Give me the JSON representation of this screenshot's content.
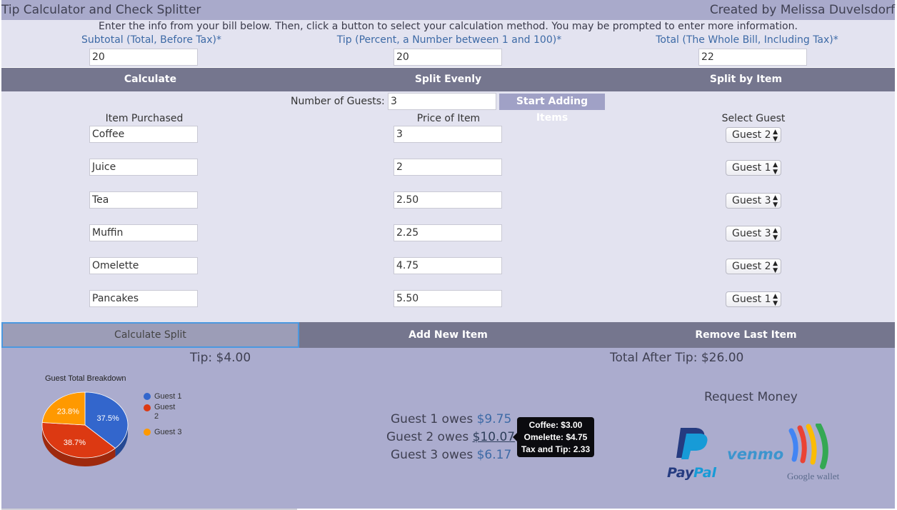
{
  "header": {
    "title": "Tip Calculator and Check Splitter",
    "author": "Created by Melissa Duvelsdorf"
  },
  "instructions": "Enter the info from your bill below. Then, click a button to select your calculation method. You may be prompted to enter more information.",
  "fields": {
    "subtotal_label": "Subtotal (Total, Before Tax)*",
    "subtotal_value": "20",
    "tip_label": "Tip (Percent, a Number between 1 and 100)*",
    "tip_value": "20",
    "total_label": "Total (The Whole Bill, Including Tax)*",
    "total_value": "22"
  },
  "methods": {
    "calculate": "Calculate",
    "split_evenly": "Split Evenly",
    "split_by_item": "Split by Item"
  },
  "guests": {
    "label": "Number of Guests:",
    "value": "3",
    "start_button": "Start Adding Items"
  },
  "columns": {
    "item": "Item Purchased",
    "price": "Price of Item",
    "guest": "Select Guest"
  },
  "items": [
    {
      "name": "Coffee",
      "price": "3",
      "guest": "Guest 2"
    },
    {
      "name": "Juice",
      "price": "2",
      "guest": "Guest 1"
    },
    {
      "name": "Tea",
      "price": "2.50",
      "guest": "Guest 3"
    },
    {
      "name": "Muffin",
      "price": "2.25",
      "guest": "Guest 3"
    },
    {
      "name": "Omelette",
      "price": "4.75",
      "guest": "Guest 2"
    },
    {
      "name": "Pancakes",
      "price": "5.50",
      "guest": "Guest 1"
    }
  ],
  "actions": {
    "calculate_split": "Calculate Split",
    "add_item": "Add New Item",
    "remove_item": "Remove Last Item"
  },
  "results": {
    "tip": "Tip: $4.00",
    "total_after_tip": "Total After Tip: $26.00",
    "owes": [
      {
        "label": "Guest 1 owes",
        "amount": "$9.75"
      },
      {
        "label": "Guest 2 owes",
        "amount": "$10.07"
      },
      {
        "label": "Guest 3 owes",
        "amount": "$6.17"
      }
    ],
    "tooltip": [
      "Coffee: $3.00",
      "Omelette: $4.75",
      "Tax and Tip: 2.33"
    ],
    "request_money": "Request Money",
    "payment_options": [
      "PayPal",
      "venmo",
      "Google wallet"
    ]
  },
  "chart_data": {
    "type": "pie",
    "title": "Guest Total Breakdown",
    "categories": [
      "Guest 1",
      "Guest 2",
      "Guest 3"
    ],
    "values": [
      37.5,
      38.7,
      23.8
    ],
    "labels": [
      "37.5%",
      "38.7%",
      "23.8%"
    ],
    "colors": [
      "#3366cc",
      "#dc3912",
      "#ff9900"
    ],
    "legend": "right",
    "style": "3d"
  },
  "colors": {
    "header": "#a9aacb",
    "panel": "#e3e3f0",
    "bar": "#75768e",
    "results": "#abacce",
    "link": "#3d6aa6"
  }
}
